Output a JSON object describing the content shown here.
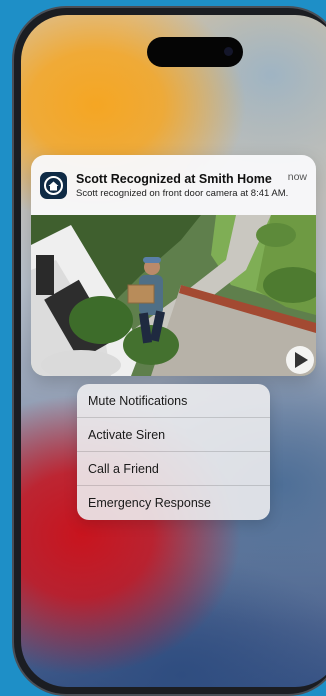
{
  "notification": {
    "app_icon": "home-icon",
    "title": "Scott Recognized at Smith Home",
    "time": "now",
    "body": "Scott recognized on front door camera at 8:41 AM.",
    "media_icon": "play-icon"
  },
  "menu": {
    "items": [
      {
        "label": "Mute Notifications"
      },
      {
        "label": "Activate Siren"
      },
      {
        "label": "Call a Friend"
      },
      {
        "label": "Emergency Response"
      }
    ]
  },
  "colors": {
    "background": "#1e8fc7",
    "app_icon_bg": "#0f2a45",
    "card_bg": "#f8f8fa",
    "menu_bg": "#ececee"
  }
}
